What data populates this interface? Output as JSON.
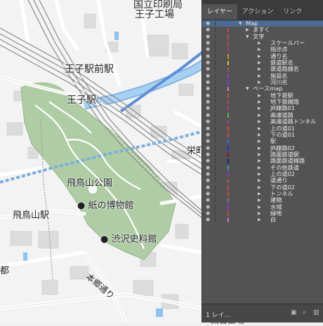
{
  "map": {
    "labels": {
      "top_institution": "国立印刷局",
      "factory": "王子工場",
      "ojiekimae": "王子駅前駅",
      "oji": "王子駅",
      "sakae": "栄町",
      "asukayama_park": "飛鳥山公園",
      "paper_museum": "紙の博物館",
      "asukayama_station": "飛鳥山駅",
      "shibusawa": "渋沢史料館",
      "hongo_street": "本郷通り",
      "bottom_right": "東日工場",
      "left_edge": "都"
    }
  },
  "panel": {
    "tabs": [
      "レイヤー",
      "アクション",
      "リンク"
    ],
    "active_tab": "レイヤー",
    "layers": [
      {
        "name": "Map",
        "depth": 0,
        "expanded": true,
        "color": "#2f6fd6",
        "selected": true
      },
      {
        "name": "ますく",
        "depth": 1,
        "expanded": false,
        "color": "#c84a4a"
      },
      {
        "name": "文字",
        "depth": 1,
        "expanded": true,
        "color": "#c84a4a"
      },
      {
        "name": "スケールバー",
        "depth": 2,
        "expanded": false,
        "color": "#c84a4a"
      },
      {
        "name": "指示点",
        "depth": 2,
        "expanded": false,
        "color": "#b0359e"
      },
      {
        "name": "通り名",
        "depth": 2,
        "expanded": false,
        "color": "#d48a3a"
      },
      {
        "name": "鉄道駅名",
        "depth": 2,
        "expanded": false,
        "color": "#d4bf3a"
      },
      {
        "name": "鉄道路線名",
        "depth": 2,
        "expanded": false,
        "color": "#c84a4a"
      },
      {
        "name": "施設名",
        "depth": 2,
        "expanded": false,
        "color": "#8a3ac8"
      },
      {
        "name": "河川名",
        "depth": 2,
        "expanded": false,
        "color": "#8a3ac8"
      },
      {
        "name": "ベースmap",
        "depth": 1,
        "expanded": true,
        "color": "#d47ad4"
      },
      {
        "name": "地下鉄駅",
        "depth": 2,
        "expanded": false,
        "color": "#c84a4a"
      },
      {
        "name": "地下鉄線路",
        "depth": 2,
        "expanded": false,
        "color": "#c84a4a"
      },
      {
        "name": "JR線路01",
        "depth": 2,
        "expanded": false,
        "color": "#b0359e"
      },
      {
        "name": "高速道路",
        "depth": 2,
        "expanded": false,
        "color": "#3ac84a"
      },
      {
        "name": "高速道路トンネル",
        "depth": 2,
        "expanded": false,
        "color": "#b0359e"
      },
      {
        "name": "上の道01",
        "depth": 2,
        "expanded": false,
        "color": "#c84a4a"
      },
      {
        "name": "下の道01",
        "depth": 2,
        "expanded": false,
        "color": "#c84a4a"
      },
      {
        "name": "駅",
        "depth": 2,
        "expanded": false,
        "color": "#2f6fd6"
      },
      {
        "name": "JR線路02",
        "depth": 2,
        "expanded": false,
        "color": "#2f2fd6"
      },
      {
        "name": "路面鉄道駅",
        "depth": 2,
        "expanded": false,
        "color": "#8a1a1a"
      },
      {
        "name": "路面鉄道線路",
        "depth": 2,
        "expanded": false,
        "color": "#1a1a8a"
      },
      {
        "name": "その他鉄道",
        "depth": 2,
        "expanded": false,
        "color": "#3a9ac8"
      },
      {
        "name": "上の道02",
        "depth": 2,
        "expanded": false,
        "color": "#8a3ac8"
      },
      {
        "name": "道通り",
        "depth": 2,
        "expanded": false,
        "color": "#c84a4a"
      },
      {
        "name": "下の道02",
        "depth": 2,
        "expanded": false,
        "color": "#c84a4a"
      },
      {
        "name": "トンネル",
        "depth": 2,
        "expanded": false,
        "color": "#c84a4a"
      },
      {
        "name": "建物",
        "depth": 2,
        "expanded": false,
        "color": "#7a7a7a"
      },
      {
        "name": "水域",
        "depth": 2,
        "expanded": false,
        "color": "#8a3ac8"
      },
      {
        "name": "緑地",
        "depth": 2,
        "expanded": false,
        "color": "#c84a4a"
      },
      {
        "name": "白",
        "depth": 2,
        "expanded": false,
        "color": "#d47ad4"
      }
    ],
    "footer": {
      "layer_count": "1 レイ..."
    }
  }
}
